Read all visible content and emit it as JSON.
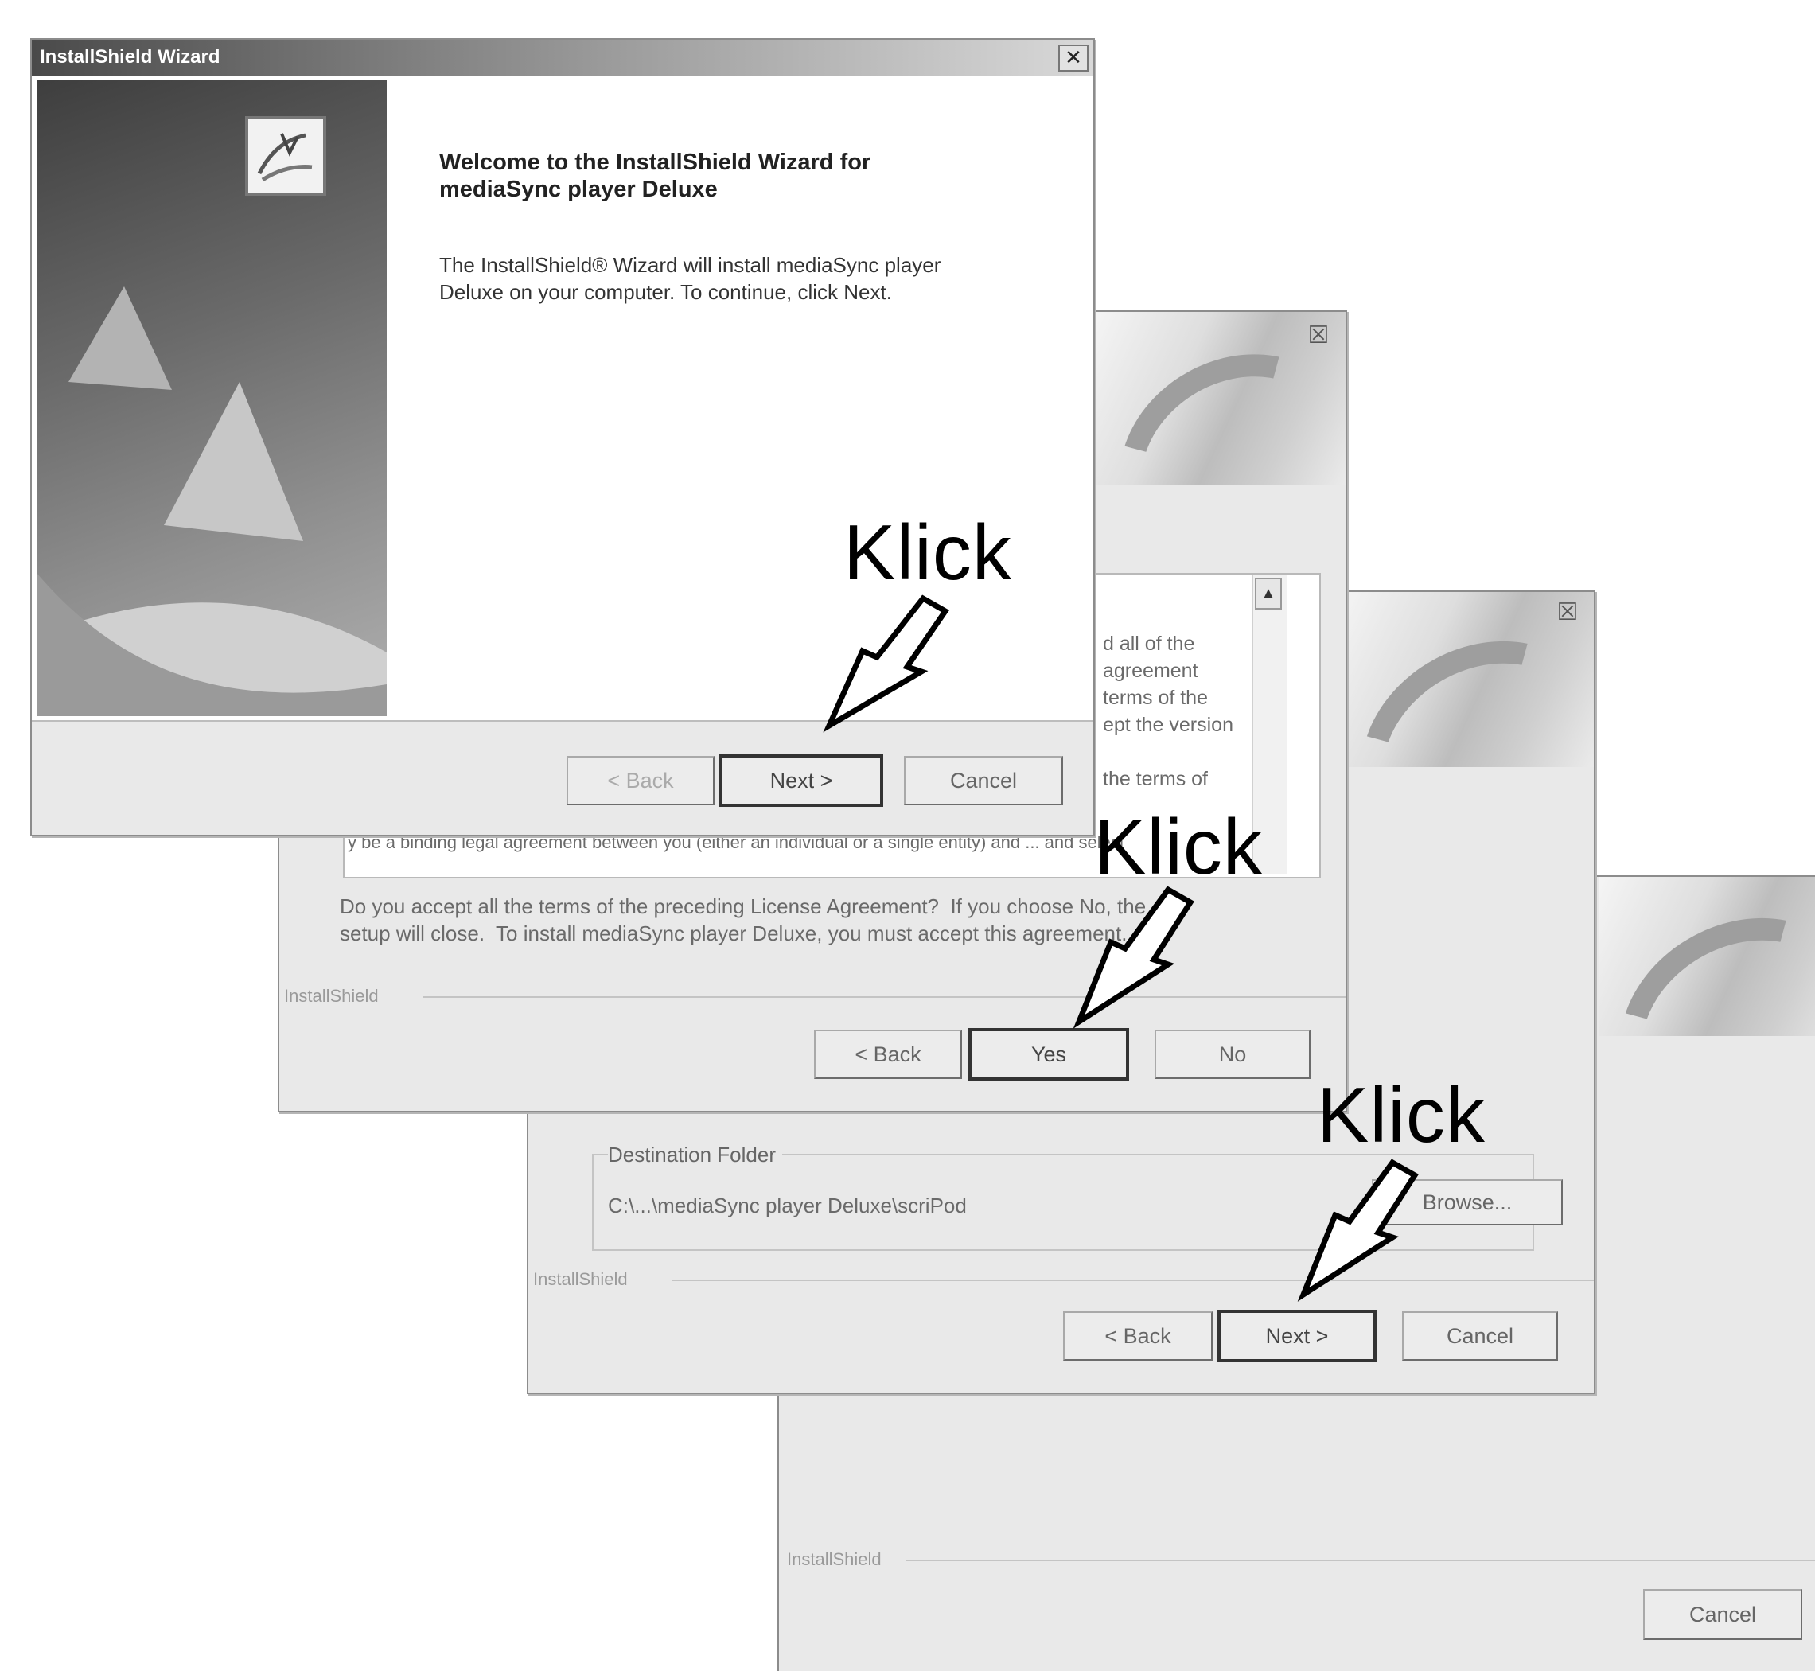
{
  "window1": {
    "title": "InstallShield Wizard",
    "heading_line1": "Welcome to the InstallShield Wizard for",
    "heading_line2": "mediaSync player Deluxe",
    "body_line1": "The InstallShield® Wizard will install mediaSync player",
    "body_line2": "Deluxe on your computer.  To continue, click Next.",
    "back_label": "< Back",
    "next_label": "Next >",
    "cancel_label": "Cancel"
  },
  "window2": {
    "license_fragment_1": "d all of the",
    "license_fragment_2": "agreement",
    "license_fragment_3": "terms of the",
    "license_fragment_4": "ept the version",
    "license_fragment_5": "the terms of",
    "license_line_bottom": "y be a binding legal agreement between you (either an individual or a single entity) and ... and select",
    "question_line1": "Do you accept all the terms of the preceding License Agreement?  If you choose No, the",
    "question_line2": "setup will close.  To install mediaSync player Deluxe, you must accept this agreement.",
    "footer_label": "InstallShield",
    "back_label": "< Back",
    "yes_label": "Yes",
    "no_label": "No"
  },
  "window3": {
    "group_label": "Destination Folder",
    "folder_path": "C:\\...\\mediaSync player Deluxe\\scriPod",
    "browse_label": "Browse...",
    "footer_label": "InstallShield",
    "back_label": "< Back",
    "next_label": "Next >",
    "cancel_label": "Cancel"
  },
  "window4": {
    "footer_label": "InstallShield",
    "cancel_label": "Cancel"
  },
  "annotations": {
    "klick_1": "Klick",
    "klick_2": "Klick",
    "klick_3": "Klick"
  }
}
